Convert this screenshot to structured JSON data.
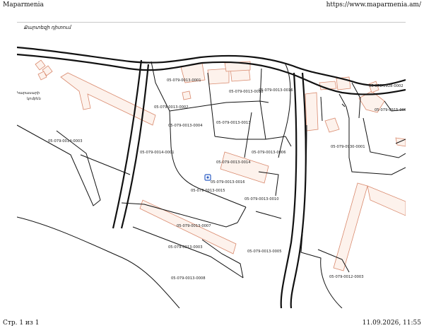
{
  "header": {
    "site_name": "Maparmenia",
    "url": "https://www.maparmenia.am/"
  },
  "footer": {
    "page": "Стр. 1 из 1",
    "datetime": "11.09.2026, 11:55"
  },
  "panel": {
    "title": "Քարտեզի դիտում"
  },
  "map": {
    "place_label": [
      "Կարասարի",
      "կոմբեն"
    ],
    "parcels": [
      "05-079-0014-0003",
      "05-079-0014-0001",
      "05-079-0013-0001",
      "05-079-0013-0002",
      "05-079-0013-0004",
      "05-079-0013-0013",
      "05-079-0013-0018",
      "05-079-0013-0016",
      "05-079-0013-0006",
      "05-079-0013-0014",
      "05-079-0013-0016",
      "05-079-0013-0015",
      "05-079-0013-0010",
      "05-079-0013-0007",
      "05-079-0013-0003",
      "05-079-0013-0005",
      "05-079-0013-0008",
      "05-079-0928-0002",
      "05-079-0915-0003",
      "05-079-0930-0001",
      "05-079-0012-0003"
    ],
    "colors": {
      "parcel_line": "#111111",
      "building": "#d98a6e",
      "building_fill": "#fdf2ec",
      "marker": "#2f5fc4"
    }
  }
}
